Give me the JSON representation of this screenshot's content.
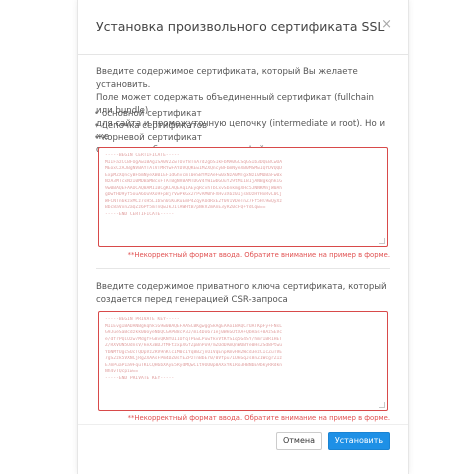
{
  "dialog": {
    "title": "Установка произвольного сертификата SSL",
    "close_glyph": "×"
  },
  "certificate": {
    "intro_line1": "Введите содержимое сертификата, который Вы желаете установить.",
    "intro_line2": "Поле может содержать объединенный сертификат (fullchain или bundle)",
    "intro_line3": "для сайта и промежуточную цепочку (intermediate и root). Но и же",
    "intro_line4": "отдельно добавьте содержимое файлов в следующем порядке:",
    "order": [
      "основной сертификат",
      "цепочка сертификатов",
      "корневой сертификат"
    ],
    "placeholder_lines": [
      "-----BEGIN CERTIFICATE-----",
      "MIIFazCCBFOgAwIBAgISA0V2ZwTOvf8TnA7d2gbS1kFbMA0GCSqGSIb3DQEBCwUA",
      "MEoxCzAJBgNVBAYTAlVTMRYwFAYDVQQKEw1MZXQncyBFbmNyeXB0MSMwIQYDVQQD",
      "ExpMZXQncyBFbmNyeXB0IEF1dGhvcml0eSBYMzAeFw0xNzA0MTgxNzI0MDBaFw0x",
      "NzA3MTcxNzI0MDBaMBcxFTATBgNVBAMTDGV4YW1wbGUuY29tMIIBIjANBgkqhkiG",
      "9w0BAQEFAAOCAQ8AMIIBCgKCAQEAq1AEyqRcvhTbCxvSbnkmgXHc5JNNKMnjW0Ah",
      "gDwfHD9yf5ouA6Ou9Xo9FpBjrVwPkGx2rPvAM0hFXHv3X6z0Ijs8OzHYHxRvL0Cj",
      "WFCNTn6kzxMCz7sH5L1bSn0iKuRuEmP4ZqyAUdRxE2f0V1VDeTnZ7Ff5Hl9wQyXz",
      "Bbc8aVxn2aQZz6Pf5mTnQwJkJ1lAWHtB7pNkV2mAnE3yRZ0cFQ+YdCqw==",
      "-----END CERTIFICATE-----"
    ],
    "error": "**Некорректный формат ввода. Обратите внимание на пример в форме."
  },
  "private_key": {
    "intro_line1": "Введите содержимое приватного ключа сертификата, который",
    "intro_line2": "создается перед генерацией CSR-запроса",
    "placeholder_lines": [
      "-----BEGIN PRIVATE KEY-----",
      "MIIEvgIBADANBgkqhkiG9w0BAQEFAASCBKgwggSkAgEAAoIBAQCrUATKpFy+FNsL",
      "G9JueSaBcdzkk00oyeNbQCGAPB8cP3J/mi4Do671ej0WkGOtXA+QbHas+8AzSEVc",
      "e/dfrPQiOzw7MdgfFG8vQKNYUI1OfqTPEwLPuwfkvVtKfSIq5G4SY/hmrIBR1HET",
      "Z/RXVUN5OdnsV/keX3BDJfMFtzxpXGfZpBnPo9/mZOdDAmQnWUBYe0Hs2Sd8Ptwu",
      "YbNMfUgcSUcTQDpVz2RV9nKlcIM0cIYq8B2jnOIVqEnpRmvHH2Wcd3ezCIcZuTVE",
      "7gS2zk5VXNCjRgZXAAsFPm4DZ0sfEZPzTnBbEr0/0Vfpu71UkGqJs8nZ1WcgrZ1z",
      "E7mPuaP1a9FquTKLCQH6bXAyE5RydMQwC1t9OU0p8AXxYK1Ro3HBNbE9bkyRRdkn",
      "Nh4vTQcpiw==",
      "-----END PRIVATE KEY-----"
    ],
    "error": "**Некорректный формат ввода. Обратите внимание на пример в форме."
  },
  "footer": {
    "cancel_label": "Отмена",
    "install_label": "Установить"
  },
  "colors": {
    "accent": "#1e90e6",
    "error": "#e05050"
  }
}
